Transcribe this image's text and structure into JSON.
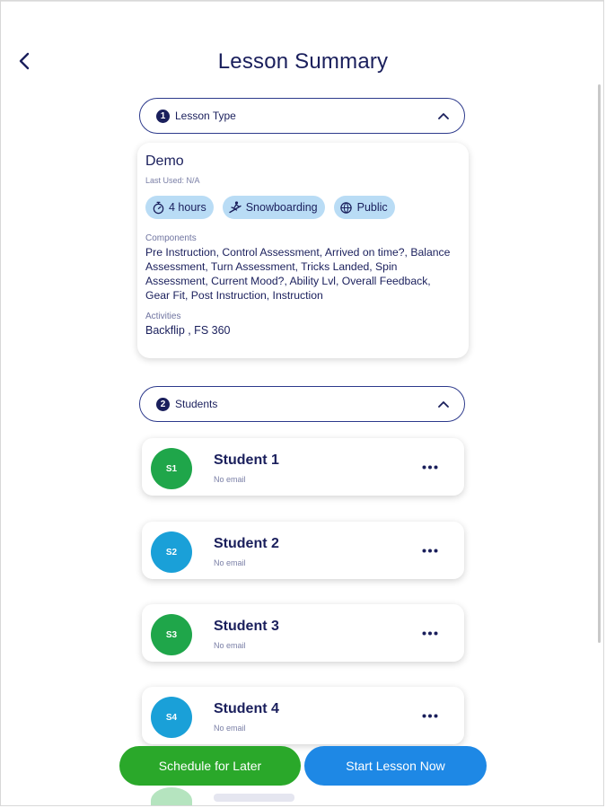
{
  "header": {
    "title": "Lesson Summary"
  },
  "lesson_type_section": {
    "number": "1",
    "label": "Lesson Type",
    "card": {
      "name": "Demo",
      "last_used": "Last Used: N/A",
      "chips": [
        {
          "icon": "stopwatch-icon",
          "label": "4 hours"
        },
        {
          "icon": "snowboarder-icon",
          "label": "Snowboarding"
        },
        {
          "icon": "globe-icon",
          "label": "Public"
        }
      ],
      "components_label": "Components",
      "components": "Pre Instruction,  Control Assessment,  Arrived on time?,  Balance Assessment,  Turn Assessment,  Tricks Landed,  Spin Assessment,  Current Mood?,  Ability Lvl,  Overall Feedback,  Gear Fit,  Post Instruction,  Instruction",
      "activities_label": "Activities",
      "activities": "Backflip ,  FS 360"
    }
  },
  "students_section": {
    "number": "2",
    "label": "Students",
    "students": [
      {
        "initials": "S1",
        "name": "Student 1",
        "email": "No email",
        "color": "#1fa64a"
      },
      {
        "initials": "S2",
        "name": "Student 2",
        "email": "No email",
        "color": "#1aa0d8"
      },
      {
        "initials": "S3",
        "name": "Student 3",
        "email": "No email",
        "color": "#1fa64a"
      },
      {
        "initials": "S4",
        "name": "Student 4",
        "email": "No email",
        "color": "#1aa0d8"
      }
    ]
  },
  "actions": {
    "schedule_later": "Schedule for Later",
    "start_now": "Start Lesson Now"
  },
  "colors": {
    "primary_text": "#1a1f5c",
    "chip_bg": "#b9dcf5",
    "schedule_button": "#2aa82a",
    "start_button": "#1e88e5"
  }
}
